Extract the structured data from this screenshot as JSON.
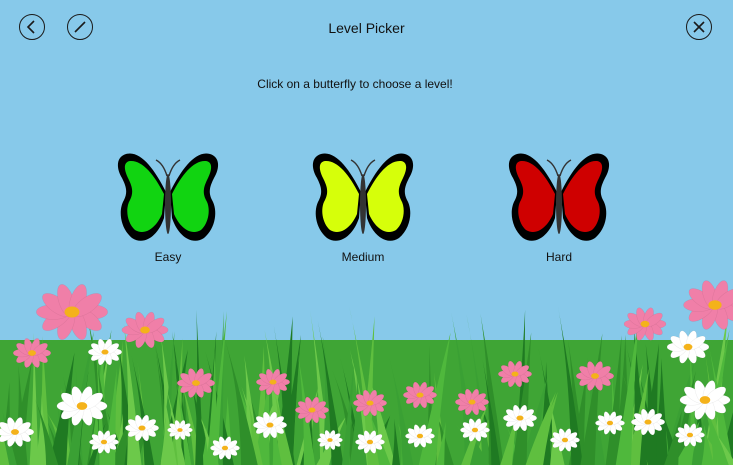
{
  "header": {
    "title": "Level Picker"
  },
  "instruction": "Click on a butterfly to choose a level!",
  "icons": {
    "back": "back-arrow-icon",
    "edit": "slash-pencil-icon",
    "close": "close-x-icon"
  },
  "levels": [
    {
      "label": "Easy",
      "color": "#11d411"
    },
    {
      "label": "Medium",
      "color": "#d6ff0a"
    },
    {
      "label": "Hard",
      "color": "#cf0000"
    }
  ],
  "colors": {
    "sky": "#87c9ea",
    "grass": "#2f9a2a",
    "flower_pink": "#f07fa8",
    "flower_white": "#ffffff",
    "flower_center": "#f4b21a"
  }
}
